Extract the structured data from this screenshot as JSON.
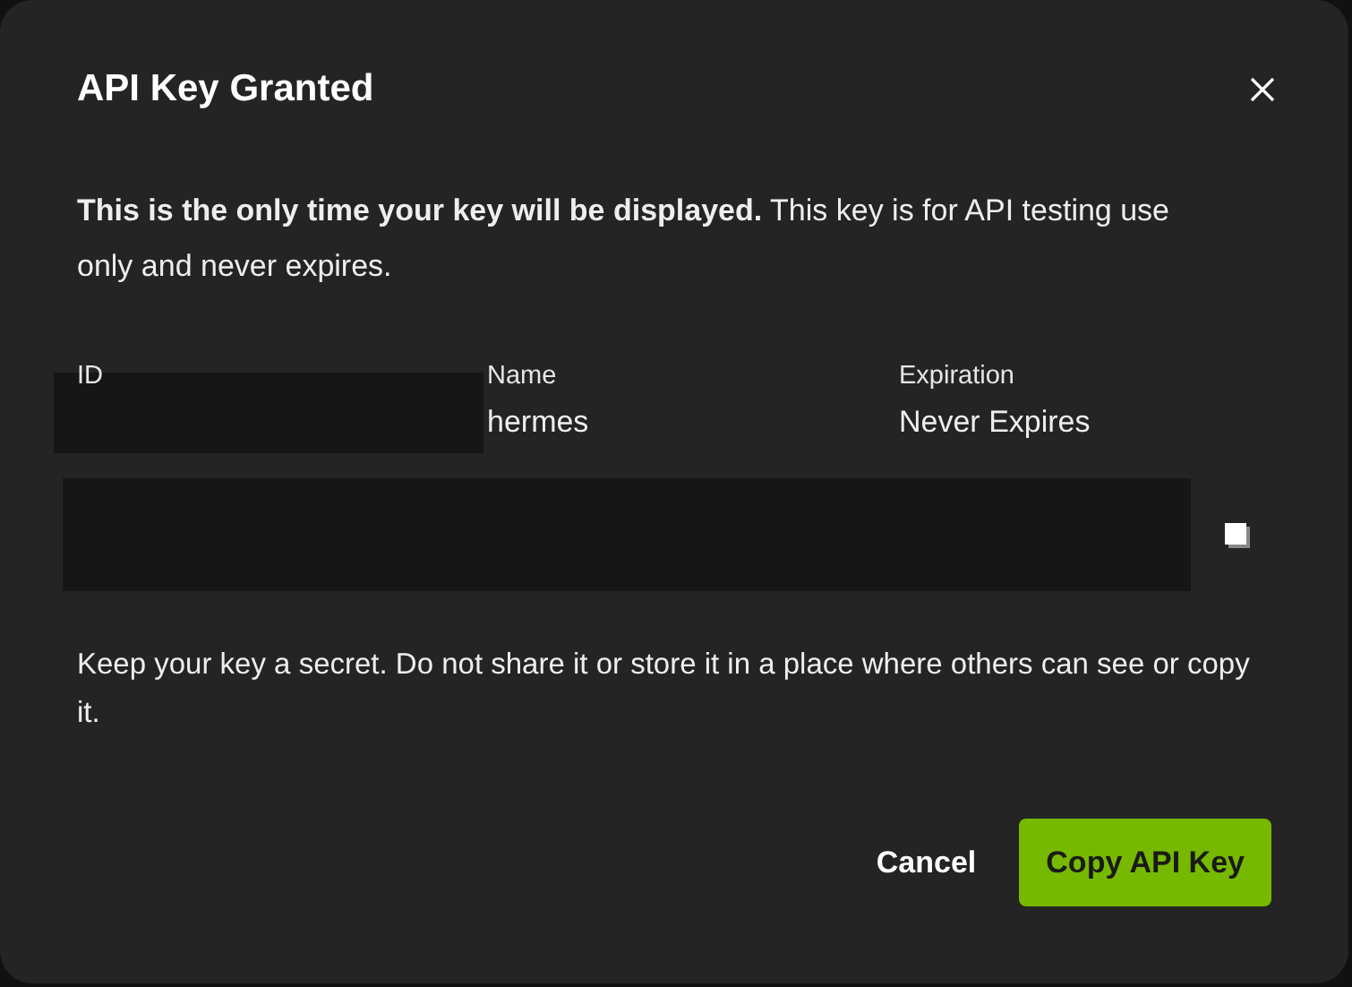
{
  "dialog": {
    "title": "API Key Granted",
    "notice": "**This is the only time your key will be displayed.** This key is for API testing use only and never expires.",
    "details": [
      {
        "label": "ID",
        "redacted": true
      },
      {
        "label": "Name",
        "value": "hermes",
        "redacted": false
      },
      {
        "label": "Expiration",
        "value": "Never Expires",
        "redacted": false
      }
    ],
    "warning": "Keep your key a secret. Do not share it or store it in a place where others can see or copy it.",
    "buttons": [
      {
        "label": "Cancel",
        "kind": "secondary"
      },
      {
        "label": "Copy API Key",
        "kind": "primary"
      }
    ]
  }
}
